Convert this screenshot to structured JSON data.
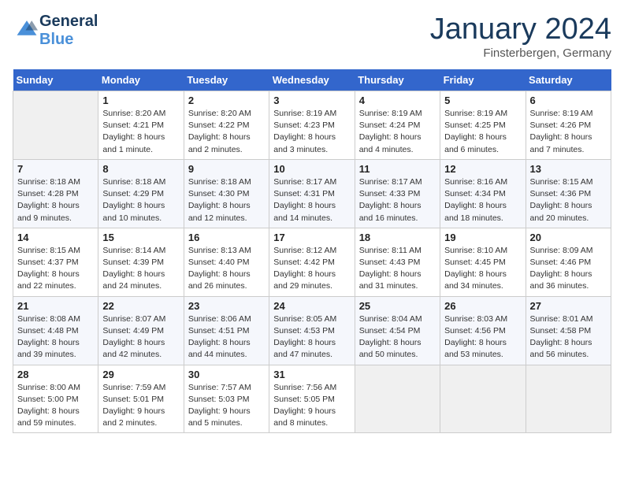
{
  "header": {
    "logo_line1": "General",
    "logo_line2": "Blue",
    "month_title": "January 2024",
    "location": "Finsterbergen, Germany"
  },
  "weekdays": [
    "Sunday",
    "Monday",
    "Tuesday",
    "Wednesday",
    "Thursday",
    "Friday",
    "Saturday"
  ],
  "weeks": [
    [
      {
        "day": "",
        "info": ""
      },
      {
        "day": "1",
        "info": "Sunrise: 8:20 AM\nSunset: 4:21 PM\nDaylight: 8 hours\nand 1 minute."
      },
      {
        "day": "2",
        "info": "Sunrise: 8:20 AM\nSunset: 4:22 PM\nDaylight: 8 hours\nand 2 minutes."
      },
      {
        "day": "3",
        "info": "Sunrise: 8:19 AM\nSunset: 4:23 PM\nDaylight: 8 hours\nand 3 minutes."
      },
      {
        "day": "4",
        "info": "Sunrise: 8:19 AM\nSunset: 4:24 PM\nDaylight: 8 hours\nand 4 minutes."
      },
      {
        "day": "5",
        "info": "Sunrise: 8:19 AM\nSunset: 4:25 PM\nDaylight: 8 hours\nand 6 minutes."
      },
      {
        "day": "6",
        "info": "Sunrise: 8:19 AM\nSunset: 4:26 PM\nDaylight: 8 hours\nand 7 minutes."
      }
    ],
    [
      {
        "day": "7",
        "info": "Sunrise: 8:18 AM\nSunset: 4:28 PM\nDaylight: 8 hours\nand 9 minutes."
      },
      {
        "day": "8",
        "info": "Sunrise: 8:18 AM\nSunset: 4:29 PM\nDaylight: 8 hours\nand 10 minutes."
      },
      {
        "day": "9",
        "info": "Sunrise: 8:18 AM\nSunset: 4:30 PM\nDaylight: 8 hours\nand 12 minutes."
      },
      {
        "day": "10",
        "info": "Sunrise: 8:17 AM\nSunset: 4:31 PM\nDaylight: 8 hours\nand 14 minutes."
      },
      {
        "day": "11",
        "info": "Sunrise: 8:17 AM\nSunset: 4:33 PM\nDaylight: 8 hours\nand 16 minutes."
      },
      {
        "day": "12",
        "info": "Sunrise: 8:16 AM\nSunset: 4:34 PM\nDaylight: 8 hours\nand 18 minutes."
      },
      {
        "day": "13",
        "info": "Sunrise: 8:15 AM\nSunset: 4:36 PM\nDaylight: 8 hours\nand 20 minutes."
      }
    ],
    [
      {
        "day": "14",
        "info": "Sunrise: 8:15 AM\nSunset: 4:37 PM\nDaylight: 8 hours\nand 22 minutes."
      },
      {
        "day": "15",
        "info": "Sunrise: 8:14 AM\nSunset: 4:39 PM\nDaylight: 8 hours\nand 24 minutes."
      },
      {
        "day": "16",
        "info": "Sunrise: 8:13 AM\nSunset: 4:40 PM\nDaylight: 8 hours\nand 26 minutes."
      },
      {
        "day": "17",
        "info": "Sunrise: 8:12 AM\nSunset: 4:42 PM\nDaylight: 8 hours\nand 29 minutes."
      },
      {
        "day": "18",
        "info": "Sunrise: 8:11 AM\nSunset: 4:43 PM\nDaylight: 8 hours\nand 31 minutes."
      },
      {
        "day": "19",
        "info": "Sunrise: 8:10 AM\nSunset: 4:45 PM\nDaylight: 8 hours\nand 34 minutes."
      },
      {
        "day": "20",
        "info": "Sunrise: 8:09 AM\nSunset: 4:46 PM\nDaylight: 8 hours\nand 36 minutes."
      }
    ],
    [
      {
        "day": "21",
        "info": "Sunrise: 8:08 AM\nSunset: 4:48 PM\nDaylight: 8 hours\nand 39 minutes."
      },
      {
        "day": "22",
        "info": "Sunrise: 8:07 AM\nSunset: 4:49 PM\nDaylight: 8 hours\nand 42 minutes."
      },
      {
        "day": "23",
        "info": "Sunrise: 8:06 AM\nSunset: 4:51 PM\nDaylight: 8 hours\nand 44 minutes."
      },
      {
        "day": "24",
        "info": "Sunrise: 8:05 AM\nSunset: 4:53 PM\nDaylight: 8 hours\nand 47 minutes."
      },
      {
        "day": "25",
        "info": "Sunrise: 8:04 AM\nSunset: 4:54 PM\nDaylight: 8 hours\nand 50 minutes."
      },
      {
        "day": "26",
        "info": "Sunrise: 8:03 AM\nSunset: 4:56 PM\nDaylight: 8 hours\nand 53 minutes."
      },
      {
        "day": "27",
        "info": "Sunrise: 8:01 AM\nSunset: 4:58 PM\nDaylight: 8 hours\nand 56 minutes."
      }
    ],
    [
      {
        "day": "28",
        "info": "Sunrise: 8:00 AM\nSunset: 5:00 PM\nDaylight: 8 hours\nand 59 minutes."
      },
      {
        "day": "29",
        "info": "Sunrise: 7:59 AM\nSunset: 5:01 PM\nDaylight: 9 hours\nand 2 minutes."
      },
      {
        "day": "30",
        "info": "Sunrise: 7:57 AM\nSunset: 5:03 PM\nDaylight: 9 hours\nand 5 minutes."
      },
      {
        "day": "31",
        "info": "Sunrise: 7:56 AM\nSunset: 5:05 PM\nDaylight: 9 hours\nand 8 minutes."
      },
      {
        "day": "",
        "info": ""
      },
      {
        "day": "",
        "info": ""
      },
      {
        "day": "",
        "info": ""
      }
    ]
  ]
}
